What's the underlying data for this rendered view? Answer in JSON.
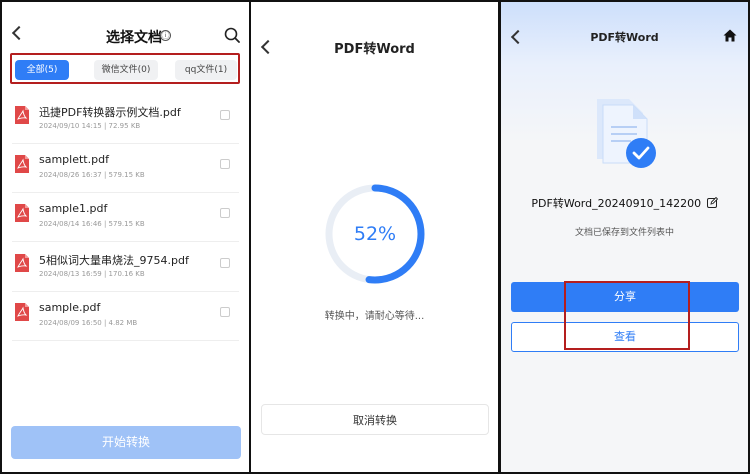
{
  "panel1": {
    "title": "选择文档",
    "info_icon": "ⓘ",
    "tabs": [
      {
        "label": "全部(5)",
        "active": true
      },
      {
        "label": "微信文件(0)",
        "active": false
      },
      {
        "label": "qq文件(1)",
        "active": false
      }
    ],
    "files": [
      {
        "name": "迅捷PDF转换器示例文档.pdf",
        "meta": "2024/09/10 14:15 | 72.95 KB"
      },
      {
        "name": "samplett.pdf",
        "meta": "2024/08/26 16:37 | 579.15 KB"
      },
      {
        "name": "sample1.pdf",
        "meta": "2024/08/14 16:46 | 579.15 KB"
      },
      {
        "name": "5相似词大量串烧法_9754.pdf",
        "meta": "2024/08/13 16:59 | 170.16 KB"
      },
      {
        "name": "sample.pdf",
        "meta": "2024/08/09 16:50 | 4.82 MB"
      }
    ],
    "start_button": "开始转换"
  },
  "panel2": {
    "title": "PDF转Word",
    "progress_label": "52%",
    "progress": 0.52,
    "status": "转换中，请耐心等待...",
    "cancel_button": "取消转换"
  },
  "panel3": {
    "title": "PDF转Word",
    "file_name": "PDF转Word_20240910_142200",
    "saved_text": "文档已保存到文件列表中",
    "share_button": "分享",
    "view_button": "查看"
  },
  "colors": {
    "accent": "#2f7df6",
    "highlight_border": "#b41e1e",
    "pdf_red": "#e04848",
    "disabled_button": "#9fc2f7"
  }
}
